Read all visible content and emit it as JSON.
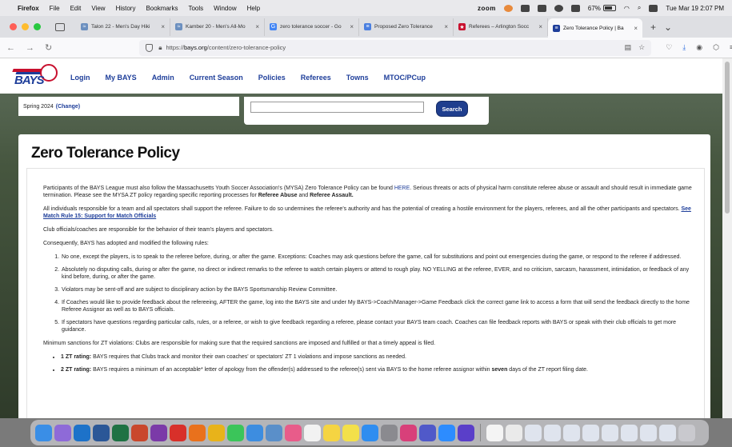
{
  "menubar": {
    "app": "Firefox",
    "items": [
      "File",
      "Edit",
      "View",
      "History",
      "Bookmarks",
      "Tools",
      "Window",
      "Help"
    ],
    "zoom": "zoom",
    "battery": "67%",
    "clock": "Tue Mar 19  2:07 PM"
  },
  "tabs": [
    {
      "title": "Talon 22 - Men's Day Hiki",
      "icon": "talon-icon",
      "color": "#6b8fbf",
      "glyph": "≈"
    },
    {
      "title": "Kamber 20 - Men's All-Mo",
      "icon": "kamber-icon",
      "color": "#6b8fbf",
      "glyph": "≈"
    },
    {
      "title": "zero tolerance soccer - Go",
      "icon": "google-icon",
      "color": "#4285f4",
      "glyph": "G"
    },
    {
      "title": "Proposed Zero Tolerance",
      "icon": "docs-icon",
      "color": "#4a7fe0",
      "glyph": "≡"
    },
    {
      "title": "Referees – Arlington Socc",
      "icon": "referees-icon",
      "color": "#c8102e",
      "glyph": "★"
    },
    {
      "title": "Zero Tolerance Policy | Ba",
      "icon": "bays-icon",
      "color": "#1e3e9a",
      "glyph": "≡"
    }
  ],
  "url": {
    "prefix": "https://",
    "domain": "bays.org",
    "path": "/content/zero-tolerance-policy"
  },
  "site": {
    "logo_text": "BAYS",
    "nav": [
      "Login",
      "My BAYS",
      "Admin",
      "Current Season",
      "Policies",
      "Referees",
      "Towns",
      "MTOC/PCup"
    ],
    "season_label": "Spring 2024",
    "season_change": "(Change)",
    "search_value": "",
    "search_button": "Search"
  },
  "article": {
    "title": "Zero Tolerance Policy",
    "p1_a": "Participants of the BAYS League must also follow the Massachusetts Youth Soccer Association's (MYSA) Zero Tolerance Policy can be found ",
    "p1_link": "HERE",
    "p1_b": ".  Serious threats or acts of physical harm constitute referee abuse or assault and should result in immediate game termination. Please see the MYSA ZT policy regarding specific reporting processes for ",
    "p1_bold1": "Referee Abuse",
    "p1_c": " and ",
    "p1_bold2": "Referee Assault.",
    "p2_a": "All individuals responsible for a team and all spectators shall support the referee. Failure to do so undermines the referee's authority and has the potential of creating a hostile environment for the players, referees, and all the other participants and spectators. ",
    "p2_link": "See Match Rule 15: Support for Match Officials",
    "p3": "Club officials/coaches are responsible for the behavior of their team's players and spectators.",
    "p4": "Consequently, BAYS has adopted and modified the following rules:",
    "rules": [
      "No one, except the players, is to speak to the referee before, during, or after the game. Exceptions: Coaches may ask questions before the game, call for substitutions and point out emergencies during the game, or respond to the referee if addressed.",
      "Absolutely no disputing calls, during or after the game, no direct or indirect remarks to the referee to watch certain players or attend to rough play. NO YELLING at the referee, EVER, and no criticism, sarcasm, harassment, intimidation, or feedback of any kind before, during, or after the game.",
      "Violators may be sent-off and are subject to disciplinary action by the BAYS Sportsmanship Review Committee.",
      "If Coaches would like to provide feedback about the refereeing, AFTER the game, log into the BAYS site and under My BAYS->Coach/Manager->Game Feedback click the correct game link to access a form that will send the feedback directly to the home Referee Assignor as well as to BAYS officials.",
      "If spectators have questions regarding particular calls, rules, or a referee, or wish to give feedback regarding a referee, please contact your BAYS team coach. Coaches can file feedback reports with BAYS or speak with their club officials to get more guidance."
    ],
    "p5": "Minimum sanctions for ZT violations: Clubs are responsible for making sure that the required sanctions are imposed and fulfilled or that a timely appeal is filed.",
    "sanctions": [
      {
        "label": "1 ZT rating:",
        "text": " BAYS requires that Clubs track and monitor their own coaches' or spectators' ZT 1 violations and impose sanctions as needed."
      },
      {
        "label": "2 ZT rating:",
        "text": " BAYS requires a minimum of an acceptable* letter of apology from the offender(s) addressed to the referee(s) sent via BAYS to the home referee assignor within ",
        "bold_tail": "seven",
        "tail": " days of the ZT report filing date."
      }
    ]
  },
  "dock": [
    {
      "name": "finder-icon",
      "color": "#3a8ee6"
    },
    {
      "name": "launchpad-icon",
      "color": "#8e6ad8"
    },
    {
      "name": "outlook-icon",
      "color": "#1d72c9"
    },
    {
      "name": "word-icon",
      "color": "#2b5797"
    },
    {
      "name": "excel-icon",
      "color": "#1f7244"
    },
    {
      "name": "powerpoint-icon",
      "color": "#c9472c"
    },
    {
      "name": "onenote-icon",
      "color": "#7b3aa8"
    },
    {
      "name": "acrobat-icon",
      "color": "#d8302a"
    },
    {
      "name": "firefox-icon",
      "color": "#e9711c"
    },
    {
      "name": "chrome-icon",
      "color": "#e8b31a"
    },
    {
      "name": "messages-icon",
      "color": "#3bc55a"
    },
    {
      "name": "mail-icon",
      "color": "#3d8de0"
    },
    {
      "name": "preview-icon",
      "color": "#5a8fc9"
    },
    {
      "name": "photos-icon",
      "color": "#e85c8a"
    },
    {
      "name": "calendar-icon",
      "color": "#f2f2f2"
    },
    {
      "name": "notes-icon",
      "color": "#f5d442"
    },
    {
      "name": "stickies-icon",
      "color": "#f3e04a"
    },
    {
      "name": "appstore-icon",
      "color": "#2f8df0"
    },
    {
      "name": "settings-icon",
      "color": "#8a8a8f"
    },
    {
      "name": "cleaner-icon",
      "color": "#d8407a"
    },
    {
      "name": "teams-icon",
      "color": "#5059c9"
    },
    {
      "name": "zoom-icon",
      "color": "#2d8cff"
    },
    {
      "name": "firefox-dev-icon",
      "color": "#5a3fc9"
    },
    {
      "name": "document-icon",
      "color": "#f4f4f4"
    },
    {
      "name": "file-icon-1",
      "color": "#eaeaea"
    },
    {
      "name": "file-icon-2",
      "color": "#dfe4ee"
    },
    {
      "name": "file-icon-3",
      "color": "#dfe4ee"
    },
    {
      "name": "file-icon-4",
      "color": "#dfe4ee"
    },
    {
      "name": "file-icon-5",
      "color": "#dfe4ee"
    },
    {
      "name": "file-icon-6",
      "color": "#dfe4ee"
    },
    {
      "name": "file-icon-7",
      "color": "#dfe4ee"
    },
    {
      "name": "file-icon-8",
      "color": "#dfe4ee"
    },
    {
      "name": "file-icon-9",
      "color": "#dfe4ee"
    },
    {
      "name": "trash-icon",
      "color": "#c9c9ce"
    }
  ]
}
